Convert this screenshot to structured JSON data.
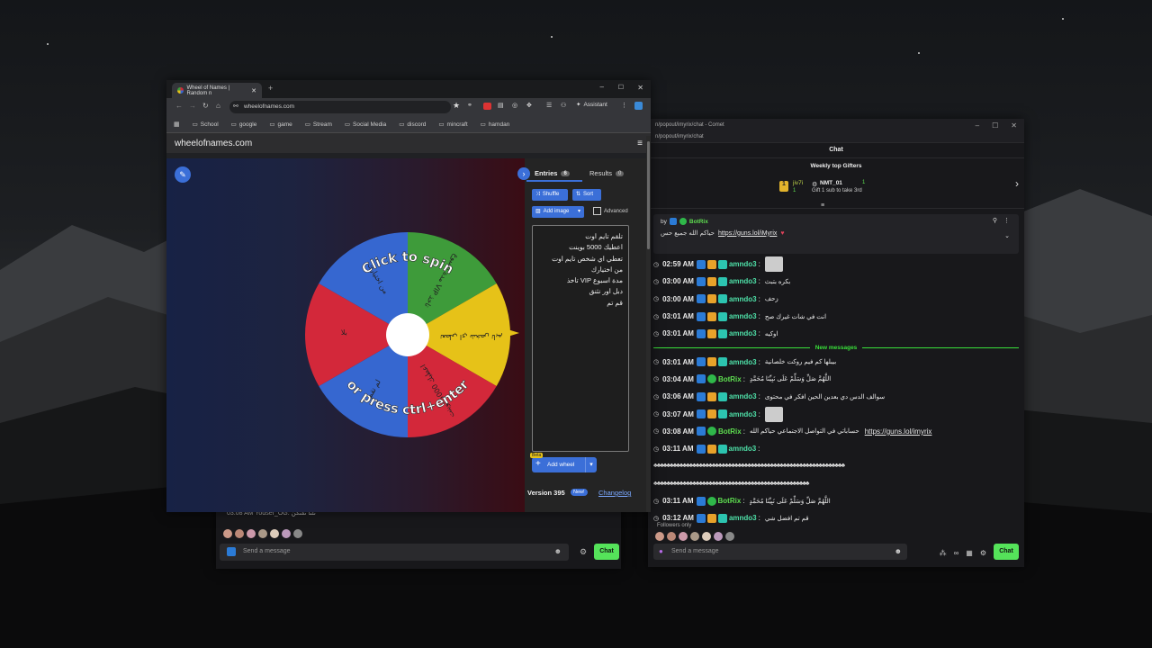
{
  "browser": {
    "tab_title": "Wheel of Names | Random n",
    "url": "wheelofnames.com",
    "assistant_label": "Assistant",
    "bookmarks": [
      "School",
      "google",
      "game",
      "Stream",
      "Social Media",
      "discord",
      "mincraft",
      "hamdan"
    ],
    "site_title": "wheelofnames.com"
  },
  "wheel": {
    "spin_text": "Click to spin",
    "press_text": "or press ctrl+enter",
    "pointer_entry": "تعطي اي شخص تايم",
    "segments": [
      {
        "label": "مدة اسبوع VIP تاخذ",
        "color": "#3e9b3a"
      },
      {
        "label": "تعطي اي شخص تايم",
        "color": "#e6c218"
      },
      {
        "label": "اعطيك 5000 بوينت",
        "color": "#d3283a"
      },
      {
        "label": "لم تقم",
        "color": "#3667d0"
      },
      {
        "label": "بلا",
        "color": "#d3283a"
      },
      {
        "label": "من اختيارك",
        "color": "#3667d0"
      }
    ]
  },
  "panel": {
    "tab_entries": "Entries",
    "entries_count": "6",
    "tab_results": "Results",
    "results_count": "0",
    "shuffle_label": "Shuffle",
    "sort_label": "Sort",
    "add_image_label": "Add image",
    "advanced_label": "Advanced",
    "entries": [
      "تلقم تايم اوت",
      "اعطيك 5000 بوينت",
      "تعطي اي شخص تايم اوت",
      "من اختيارك",
      "مدة اسبوع VIP تاخذ",
      "دبل اور نثنق",
      "قم تم"
    ],
    "beta_label": "Beta",
    "add_wheel_label": "Add wheel",
    "version_label": "Version 395",
    "new_badge": "New!",
    "changelog_label": "Changelog"
  },
  "chat": {
    "window_address": "n/popout/imyrix/chat - Comet",
    "window_address2": "n/popout/imyrix/chat",
    "header": "Chat",
    "gifters_title": "Weekly top Gifters",
    "gifter1_name": "jiv7i",
    "gifter1_count": "1",
    "gifter2_name": "NMT_01",
    "gifter2_count": "1",
    "gift_hint": "Gift 1 sub to take 3rd",
    "pinned_by": "by",
    "pinned_user": "BotRix",
    "pinned_text": "حياكم الله جميع حس",
    "pinned_link": "https://guns.lol/iMyrix",
    "new_messages_label": "New messages",
    "messages_before": [
      {
        "time": "02:59 AM",
        "user": "amndo3",
        "text": "",
        "kind": "g",
        "image": true
      },
      {
        "time": "03:00 AM",
        "user": "amndo3",
        "text": "بكره بتبث",
        "kind": "g"
      },
      {
        "time": "03:00 AM",
        "user": "amndo3",
        "text": "زحف",
        "kind": "g"
      },
      {
        "time": "03:01 AM",
        "user": "amndo3",
        "text": "انت في شات غيرك صح",
        "kind": "g"
      },
      {
        "time": "03:01 AM",
        "user": "amndo3",
        "text": "اوكيه",
        "kind": "g"
      }
    ],
    "messages_after": [
      {
        "time": "03:01 AM",
        "user": "amndo3",
        "text": "بيبلها كم فيم روكت خلصانية",
        "kind": "g"
      },
      {
        "time": "03:04 AM",
        "user": "BotRix",
        "text": "اللَّهُمَّ صَلِّ وَسَلِّمْ عَلَى نَبِيِّنَا مُحَمَّدٍ",
        "kind": "b"
      },
      {
        "time": "03:06 AM",
        "user": "amndo3",
        "text": "سوالف الدس دي بعدين الحين افكر في محتوى",
        "kind": "g"
      },
      {
        "time": "03:07 AM",
        "user": "amndo3",
        "text": "",
        "kind": "g",
        "image": true
      },
      {
        "time": "03:08 AM",
        "user": "BotRix",
        "text": "حساباتي في التواصل الاجتماعي حياكم الله",
        "link": "https://guns.lol/imyrix",
        "kind": "b"
      },
      {
        "time": "03:11 AM",
        "user": "amndo3",
        "text": "",
        "kind": "g"
      },
      {
        "time": "",
        "user": "",
        "text": "♣♣♣♣♣♣♣♣♣♣♣♣♣♣♣♣♣♣♣♣♣♣♣♣♣♣♣♣♣♣♣♣♣♣♣♣♣♣♣♣♣♣♣♣♣♣♣♣♣♣♣♣♣♣♣♣♣♣♣",
        "kind": "x"
      },
      {
        "time": "",
        "user": "",
        "text": "♣♣♣♣♣♣♣♣♣♣♣♣♣♣♣♣♣♣♣♣♣♣♣♣♣♣♣♣♣♣♣♣♣♣♣♣♣♣♣♣♣♣♣♣♣♣♣♣",
        "kind": "x"
      },
      {
        "time": "03:11 AM",
        "user": "BotRix",
        "text": "اللَّهُمَّ صَلِّ وَسَلِّمْ عَلَى نَبِيِّنَا مُحَمَّدٍ",
        "kind": "b"
      },
      {
        "time": "03:12 AM",
        "user": "amndo3",
        "text": "قم تم افضل شي",
        "kind": "g"
      }
    ],
    "followers_only": "Followers only",
    "placeholder": "Send a message",
    "send_label": "Chat"
  },
  "chat2": {
    "partial_line": "03:08 AM Yodser_OG: ثلنا ثقتكن",
    "placeholder": "Send a message",
    "send_label": "Chat"
  }
}
